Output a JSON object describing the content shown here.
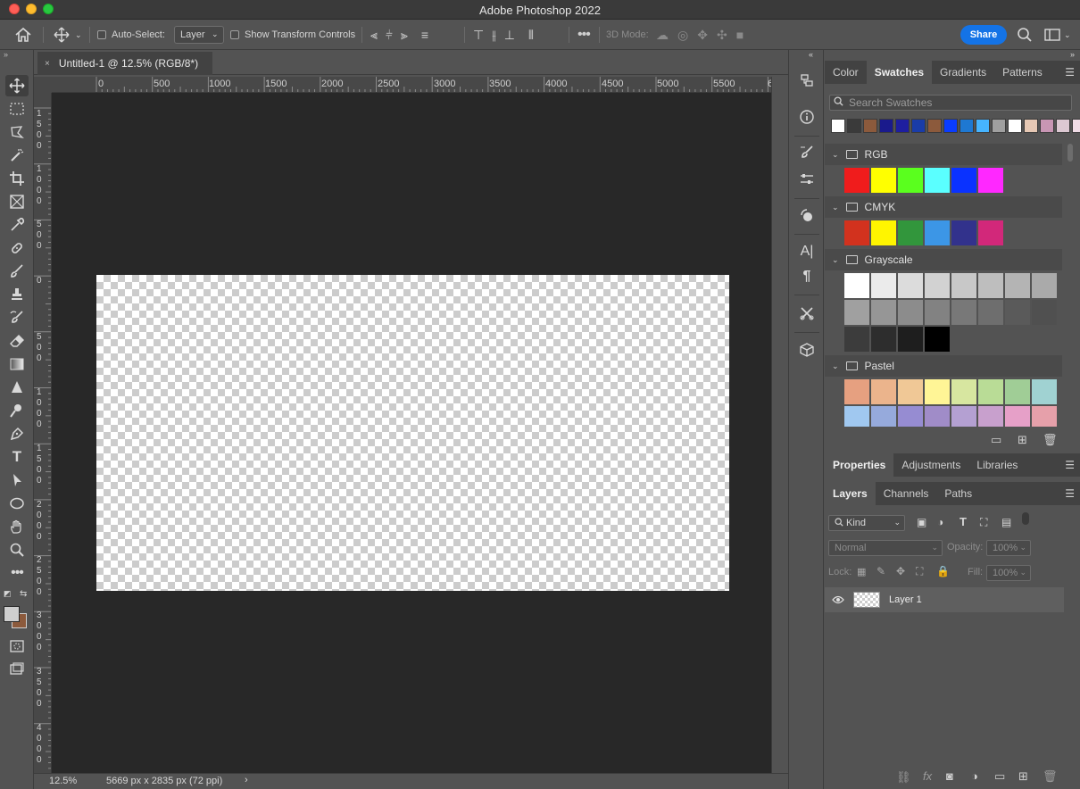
{
  "window": {
    "title": "Adobe Photoshop 2022"
  },
  "options_bar": {
    "auto_select_label": "Auto-Select:",
    "auto_select_value": "Layer",
    "show_transform_label": "Show Transform Controls",
    "three_d_mode_label": "3D Mode:",
    "share_label": "Share"
  },
  "document_tab": {
    "title": "Untitled-1 @ 12.5% (RGB/8*)",
    "close": "×"
  },
  "ruler": {
    "top_labels": [
      "0",
      "500",
      "1000",
      "1500",
      "2000",
      "2500",
      "3000",
      "3500",
      "4000",
      "4500",
      "5000",
      "5500",
      "6"
    ],
    "left_labels": [
      "1500",
      "1000",
      "500",
      "0",
      "500",
      "1000",
      "1500",
      "2000",
      "2500",
      "3000",
      "3500",
      "4000"
    ]
  },
  "status_bar": {
    "zoom": "12.5%",
    "doc_size": "5669 px x 2835 px (72 ppi)",
    "arrow": "›"
  },
  "swatches_panel": {
    "tabs": [
      "Color",
      "Swatches",
      "Gradients",
      "Patterns"
    ],
    "active_tab": "Swatches",
    "search_placeholder": "Search Swatches",
    "recent": [
      "#ffffff",
      "#3a3a3a",
      "#8c5a3c",
      "#1a1a8c",
      "#1e1ea0",
      "#1a3ca8",
      "#8c5a3c",
      "#0a3cff",
      "#1e78d2",
      "#46b4ff",
      "#a0a0a0",
      "#ffffff",
      "#e6c8b4",
      "#c896b4",
      "#dcc8d2",
      "#f0dce6"
    ],
    "groups": [
      {
        "name": "RGB",
        "rows": [
          [
            "#f01c1c",
            "#ffff00",
            "#5aff1e",
            "#5affff",
            "#0a32ff",
            "#ff28ff"
          ]
        ]
      },
      {
        "name": "CMYK",
        "rows": [
          [
            "#d2321e",
            "#fff500",
            "#32963c",
            "#3c96e6",
            "#32328c",
            "#d2287a"
          ]
        ]
      },
      {
        "name": "Grayscale",
        "rows": [
          [
            "#ffffff",
            "#ebebeb",
            "#dcdcdc",
            "#d2d2d2",
            "#c8c8c8",
            "#bebebe",
            "#b4b4b4",
            "#aaaaaa"
          ],
          [
            "#a0a0a0",
            "#969696",
            "#8c8c8c",
            "#828282",
            "#787878",
            "#6e6e6e",
            "#5a5a5a",
            "#505050"
          ],
          [
            "#3c3c3c",
            "#2d2d2d",
            "#1e1e1e",
            "#000000"
          ]
        ]
      },
      {
        "name": "Pastel",
        "rows": [
          [
            "#e6a080",
            "#ebb48c",
            "#f0c896",
            "#fff596",
            "#d7e6a0",
            "#b9dc96",
            "#a0cd96",
            "#a0d2d2"
          ],
          [
            "#a0c8f0",
            "#96aadc",
            "#968cd2",
            "#a08cc8",
            "#b4a0d2",
            "#c8a0cd",
            "#e6a0c8",
            "#e6a0aa"
          ]
        ]
      }
    ]
  },
  "properties_panel": {
    "tabs": [
      "Properties",
      "Adjustments",
      "Libraries"
    ],
    "active_tab": "Properties"
  },
  "layers_panel": {
    "tabs": [
      "Layers",
      "Channels",
      "Paths"
    ],
    "active_tab": "Layers",
    "kind_label": "Kind",
    "blend_mode": "Normal",
    "opacity_label": "Opacity:",
    "opacity_value": "100%",
    "lock_label": "Lock:",
    "fill_label": "Fill:",
    "fill_value": "100%",
    "layers": [
      {
        "name": "Layer 1",
        "visible": true
      }
    ]
  },
  "colors": {
    "accent": "#1473e6",
    "foreground": "#cfcfcf",
    "background": "#8c5a3c"
  }
}
